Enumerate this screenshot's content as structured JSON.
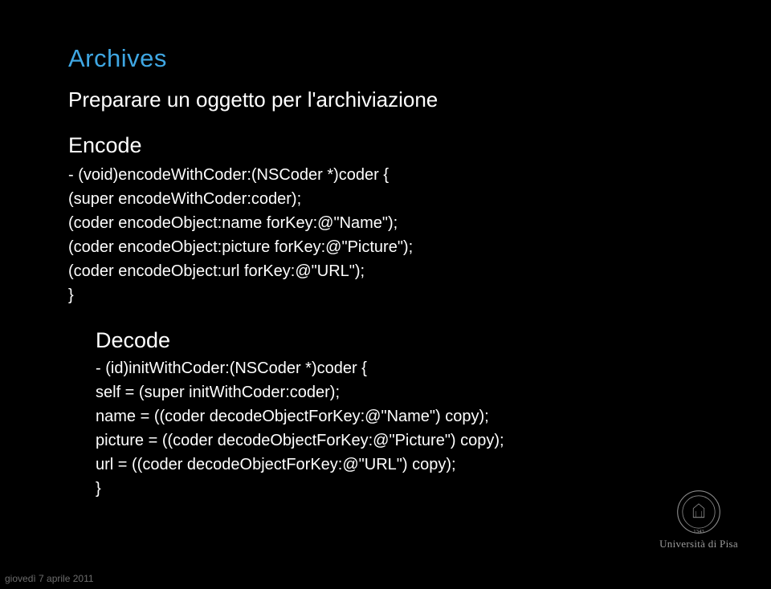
{
  "title": "Archives",
  "subtitle": "Preparare un oggetto per l'archiviazione",
  "encode": {
    "heading": "Encode",
    "lines": [
      "- (void)encodeWithCoder:(NSCoder *)coder {",
      "(super encodeWithCoder:coder);",
      "(coder encodeObject:name forKey:@\"Name\");",
      "(coder encodeObject:picture forKey:@\"Picture\");",
      "(coder encodeObject:url forKey:@\"URL\");",
      "}"
    ]
  },
  "decode": {
    "heading": "Decode",
    "lines": [
      "- (id)initWithCoder:(NSCoder *)coder {",
      "self = (super initWithCoder:coder);",
      "name = ((coder decodeObjectForKey:@\"Name\") copy);",
      "picture = ((coder decodeObjectForKey:@\"Picture\") copy);",
      "url = ((coder decodeObjectForKey:@\"URL\") copy);",
      "}"
    ]
  },
  "university": {
    "name": "Università di Pisa",
    "year": "1343"
  },
  "footer_date": "giovedì 7 aprile 2011"
}
